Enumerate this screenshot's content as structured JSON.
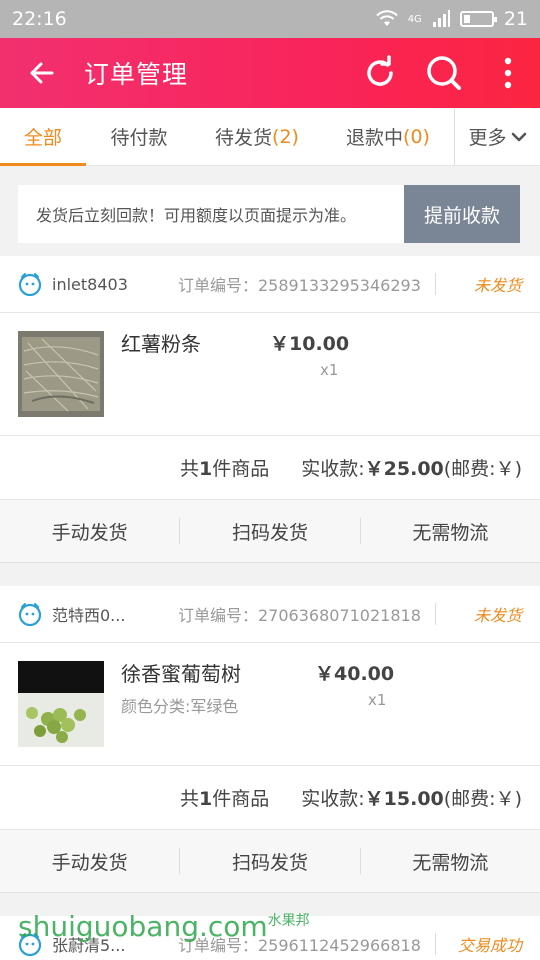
{
  "statusbar": {
    "time": "22:16",
    "network": "4G",
    "battery": "21"
  },
  "appbar": {
    "title": "订单管理"
  },
  "tabs": [
    {
      "label": "全部",
      "count": ""
    },
    {
      "label": "待付款",
      "count": ""
    },
    {
      "label": "待发货",
      "count": "(2)"
    },
    {
      "label": "退款中",
      "count": "(0)"
    },
    {
      "label": "更多",
      "count": ""
    }
  ],
  "notice": {
    "text": "发货后立刻回款！可用额度以页面提示为准。",
    "button": "提前收款"
  },
  "orders": [
    {
      "buyer": "inlet8403",
      "order_no": "订单编号：2589133295346293",
      "status": "未发货",
      "product": "红薯粉条",
      "spec": "",
      "price": "￥10.00",
      "qty": "x1",
      "count_prefix": "共",
      "count_num": "1",
      "count_suffix": "件商品",
      "paid_label": "实收款:",
      "paid_amount": "￥25.00",
      "postage": "(邮费:￥)",
      "actions": [
        "手动发货",
        "扫码发货",
        "无需物流"
      ]
    },
    {
      "buyer": "范特西0...",
      "order_no": "订单编号：2706368071021818",
      "status": "未发货",
      "product": "徐香蜜葡萄树",
      "spec": "颜色分类:军绿色",
      "price": "￥40.00",
      "qty": "x1",
      "count_prefix": "共",
      "count_num": "1",
      "count_suffix": "件商品",
      "paid_label": "实收款:",
      "paid_amount": "￥15.00",
      "postage": "(邮费:￥)",
      "actions": [
        "手动发货",
        "扫码发货",
        "无需物流"
      ]
    },
    {
      "buyer": "张蔚清5...",
      "order_no": "订单编号：2596112452966818",
      "status": "交易成功"
    }
  ],
  "watermark": {
    "text": "shuiguobang.com",
    "tag": "水果邦"
  },
  "colors": {
    "accent": "#f08a1c",
    "appbar": "#f9245a",
    "notice_button": "#7a8595"
  },
  "icons": [
    "back-arrow-icon",
    "refresh-icon",
    "search-icon",
    "more-vertical-icon",
    "chevron-down-icon",
    "buyer-avatar-icon",
    "wifi-icon",
    "signal-icon",
    "battery-icon"
  ]
}
